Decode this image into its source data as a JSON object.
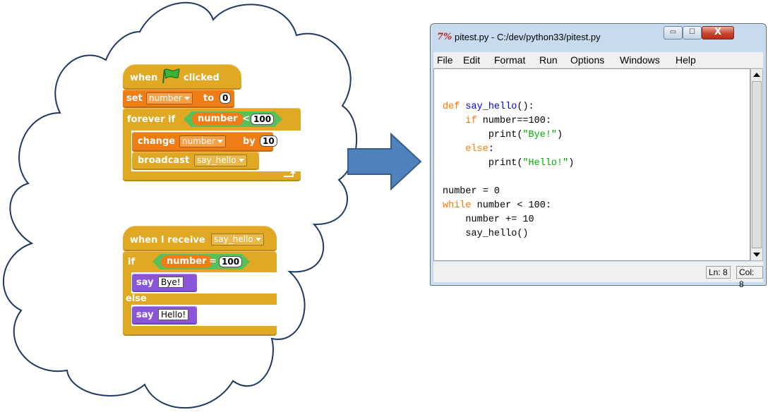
{
  "scratch": {
    "script1": {
      "hat_when": "when",
      "hat_clicked": "clicked",
      "set_label": "set",
      "set_var": "number",
      "set_to": "to",
      "set_value": "0",
      "forever_if_label": "forever if",
      "cond_var": "number",
      "cond_op": "<",
      "cond_value": "100",
      "change_label": "change",
      "change_var": "number",
      "change_by": "by",
      "change_value": "10",
      "broadcast_label": "broadcast",
      "broadcast_msg": "say_hello"
    },
    "script2": {
      "hat_label": "when I receive",
      "hat_msg": "say_hello",
      "if_label": "if",
      "cond_var": "number",
      "cond_op": "=",
      "cond_value": "100",
      "say1_label": "say",
      "say1_text": "Bye!",
      "else_label": "else",
      "say2_label": "say",
      "say2_text": "Hello!"
    }
  },
  "window": {
    "title": "pitest.py - C:/dev/python33/pitest.py",
    "icon_text": "7%",
    "menu": [
      "File",
      "Edit",
      "Format",
      "Run",
      "Options",
      "Windows",
      "Help"
    ],
    "status_ln": "Ln: 8",
    "status_col": "Col: 8",
    "btn_min_glyph": "▭",
    "btn_max_glyph": "☐",
    "btn_close_glyph": "X"
  },
  "code": {
    "l1_kw": "def",
    "l1_fn": "say_hello",
    "l1_rest": "():",
    "l2_kw": "if",
    "l2_rest": " number==100:",
    "l3_pre": "print(",
    "l3_str": "\"Bye!\"",
    "l3_post": ")",
    "l4_kw": "else",
    "l4_rest": ":",
    "l5_pre": "print(",
    "l5_str": "\"Hello!\"",
    "l5_post": ")",
    "l6": "number = 0",
    "l7_kw": "while",
    "l7_rest": " number < 100:",
    "l8": "number += 10",
    "l9": "say_hello()"
  },
  "colors": {
    "cloud_stroke": "#1f3864",
    "arrow_fill": "#4f81bd",
    "arrow_stroke": "#385d8a",
    "control": "#e1a823",
    "variables": "#ee7d16",
    "operators": "#59c059",
    "looks": "#8a55d7",
    "py_keyword": "#ff7700",
    "py_defname": "#0000ff",
    "py_string": "#00aa00"
  }
}
